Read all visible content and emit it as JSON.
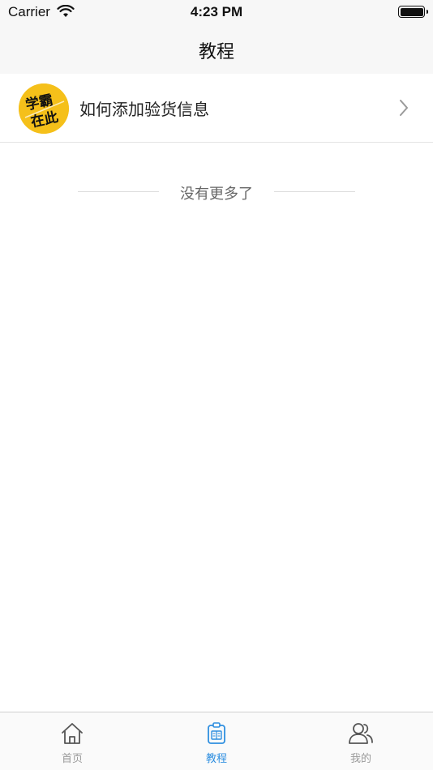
{
  "status_bar": {
    "carrier": "Carrier",
    "time": "4:23 PM"
  },
  "nav": {
    "title": "教程"
  },
  "tutorials": [
    {
      "title": "如何添加验货信息",
      "thumbnail_icon": "xueba-zaici-badge",
      "thumbnail_text_top": "学霸",
      "thumbnail_text_bottom": "在此"
    }
  ],
  "list_end": {
    "text": "没有更多了"
  },
  "tab_bar": {
    "tabs": [
      {
        "label": "首页",
        "icon": "home-icon",
        "active": false
      },
      {
        "label": "教程",
        "icon": "tutorial-icon",
        "active": true
      },
      {
        "label": "我的",
        "icon": "profile-icon",
        "active": false
      }
    ]
  },
  "colors": {
    "active_tab": "#2f8fe0",
    "inactive_tab": "#9a9a9a",
    "badge_yellow": "#f5c01a",
    "bar_background": "#f7f7f7"
  }
}
